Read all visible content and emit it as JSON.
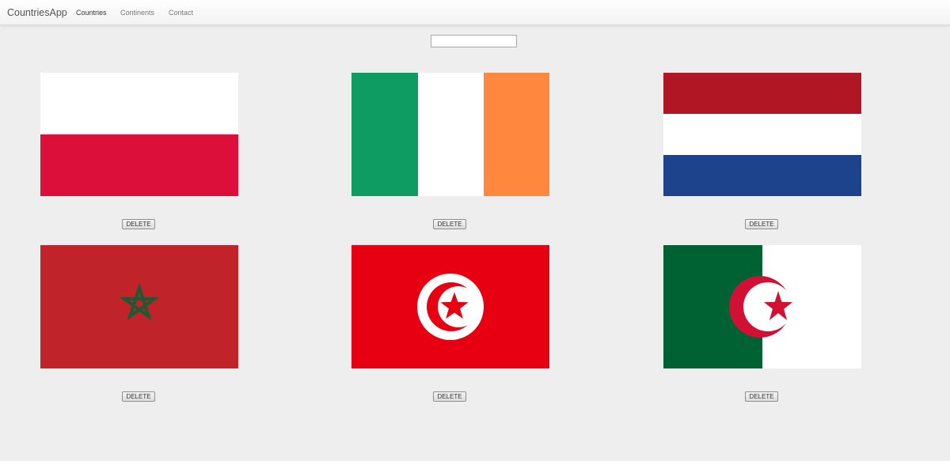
{
  "navbar": {
    "brand": "CountriesApp",
    "links": [
      {
        "label": "Countries",
        "active": true
      },
      {
        "label": "Continents",
        "active": false
      },
      {
        "label": "Contact",
        "active": false
      }
    ]
  },
  "search": {
    "value": "",
    "placeholder": ""
  },
  "countries": [
    {
      "flag": "poland-flag",
      "delete_label": "DELETE"
    },
    {
      "flag": "ireland-flag",
      "delete_label": "DELETE"
    },
    {
      "flag": "netherlands-flag",
      "delete_label": "DELETE"
    },
    {
      "flag": "morocco-flag",
      "delete_label": "DELETE"
    },
    {
      "flag": "tunisia-flag",
      "delete_label": "DELETE"
    },
    {
      "flag": "algeria-flag",
      "delete_label": "DELETE"
    }
  ],
  "colors": {
    "page_background": "#eeeeee",
    "poland_red": "#dc0e3a",
    "ireland_green": "#0e9c62",
    "ireland_orange": "#ff883e",
    "netherlands_red": "#b01623",
    "netherlands_blue": "#1d438d",
    "morocco_red": "#c1232b",
    "morocco_green": "#1d5a32",
    "tunisia_red": "#e70012",
    "algeria_green": "#006233",
    "algeria_red": "#d21034"
  }
}
